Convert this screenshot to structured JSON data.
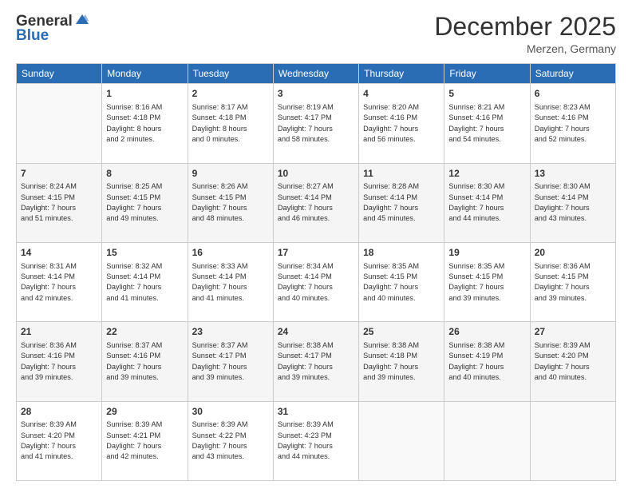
{
  "header": {
    "logo": {
      "line1": "General",
      "line2": "Blue"
    },
    "title": "December 2025",
    "subtitle": "Merzen, Germany"
  },
  "calendar": {
    "days_of_week": [
      "Sunday",
      "Monday",
      "Tuesday",
      "Wednesday",
      "Thursday",
      "Friday",
      "Saturday"
    ],
    "weeks": [
      {
        "days": [
          {
            "num": "",
            "info": ""
          },
          {
            "num": "1",
            "info": "Sunrise: 8:16 AM\nSunset: 4:18 PM\nDaylight: 8 hours\nand 2 minutes."
          },
          {
            "num": "2",
            "info": "Sunrise: 8:17 AM\nSunset: 4:18 PM\nDaylight: 8 hours\nand 0 minutes."
          },
          {
            "num": "3",
            "info": "Sunrise: 8:19 AM\nSunset: 4:17 PM\nDaylight: 7 hours\nand 58 minutes."
          },
          {
            "num": "4",
            "info": "Sunrise: 8:20 AM\nSunset: 4:16 PM\nDaylight: 7 hours\nand 56 minutes."
          },
          {
            "num": "5",
            "info": "Sunrise: 8:21 AM\nSunset: 4:16 PM\nDaylight: 7 hours\nand 54 minutes."
          },
          {
            "num": "6",
            "info": "Sunrise: 8:23 AM\nSunset: 4:16 PM\nDaylight: 7 hours\nand 52 minutes."
          }
        ]
      },
      {
        "days": [
          {
            "num": "7",
            "info": "Sunrise: 8:24 AM\nSunset: 4:15 PM\nDaylight: 7 hours\nand 51 minutes."
          },
          {
            "num": "8",
            "info": "Sunrise: 8:25 AM\nSunset: 4:15 PM\nDaylight: 7 hours\nand 49 minutes."
          },
          {
            "num": "9",
            "info": "Sunrise: 8:26 AM\nSunset: 4:15 PM\nDaylight: 7 hours\nand 48 minutes."
          },
          {
            "num": "10",
            "info": "Sunrise: 8:27 AM\nSunset: 4:14 PM\nDaylight: 7 hours\nand 46 minutes."
          },
          {
            "num": "11",
            "info": "Sunrise: 8:28 AM\nSunset: 4:14 PM\nDaylight: 7 hours\nand 45 minutes."
          },
          {
            "num": "12",
            "info": "Sunrise: 8:30 AM\nSunset: 4:14 PM\nDaylight: 7 hours\nand 44 minutes."
          },
          {
            "num": "13",
            "info": "Sunrise: 8:30 AM\nSunset: 4:14 PM\nDaylight: 7 hours\nand 43 minutes."
          }
        ]
      },
      {
        "days": [
          {
            "num": "14",
            "info": "Sunrise: 8:31 AM\nSunset: 4:14 PM\nDaylight: 7 hours\nand 42 minutes."
          },
          {
            "num": "15",
            "info": "Sunrise: 8:32 AM\nSunset: 4:14 PM\nDaylight: 7 hours\nand 41 minutes."
          },
          {
            "num": "16",
            "info": "Sunrise: 8:33 AM\nSunset: 4:14 PM\nDaylight: 7 hours\nand 41 minutes."
          },
          {
            "num": "17",
            "info": "Sunrise: 8:34 AM\nSunset: 4:14 PM\nDaylight: 7 hours\nand 40 minutes."
          },
          {
            "num": "18",
            "info": "Sunrise: 8:35 AM\nSunset: 4:15 PM\nDaylight: 7 hours\nand 40 minutes."
          },
          {
            "num": "19",
            "info": "Sunrise: 8:35 AM\nSunset: 4:15 PM\nDaylight: 7 hours\nand 39 minutes."
          },
          {
            "num": "20",
            "info": "Sunrise: 8:36 AM\nSunset: 4:15 PM\nDaylight: 7 hours\nand 39 minutes."
          }
        ]
      },
      {
        "days": [
          {
            "num": "21",
            "info": "Sunrise: 8:36 AM\nSunset: 4:16 PM\nDaylight: 7 hours\nand 39 minutes."
          },
          {
            "num": "22",
            "info": "Sunrise: 8:37 AM\nSunset: 4:16 PM\nDaylight: 7 hours\nand 39 minutes."
          },
          {
            "num": "23",
            "info": "Sunrise: 8:37 AM\nSunset: 4:17 PM\nDaylight: 7 hours\nand 39 minutes."
          },
          {
            "num": "24",
            "info": "Sunrise: 8:38 AM\nSunset: 4:17 PM\nDaylight: 7 hours\nand 39 minutes."
          },
          {
            "num": "25",
            "info": "Sunrise: 8:38 AM\nSunset: 4:18 PM\nDaylight: 7 hours\nand 39 minutes."
          },
          {
            "num": "26",
            "info": "Sunrise: 8:38 AM\nSunset: 4:19 PM\nDaylight: 7 hours\nand 40 minutes."
          },
          {
            "num": "27",
            "info": "Sunrise: 8:39 AM\nSunset: 4:20 PM\nDaylight: 7 hours\nand 40 minutes."
          }
        ]
      },
      {
        "days": [
          {
            "num": "28",
            "info": "Sunrise: 8:39 AM\nSunset: 4:20 PM\nDaylight: 7 hours\nand 41 minutes."
          },
          {
            "num": "29",
            "info": "Sunrise: 8:39 AM\nSunset: 4:21 PM\nDaylight: 7 hours\nand 42 minutes."
          },
          {
            "num": "30",
            "info": "Sunrise: 8:39 AM\nSunset: 4:22 PM\nDaylight: 7 hours\nand 43 minutes."
          },
          {
            "num": "31",
            "info": "Sunrise: 8:39 AM\nSunset: 4:23 PM\nDaylight: 7 hours\nand 44 minutes."
          },
          {
            "num": "",
            "info": ""
          },
          {
            "num": "",
            "info": ""
          },
          {
            "num": "",
            "info": ""
          }
        ]
      }
    ]
  }
}
